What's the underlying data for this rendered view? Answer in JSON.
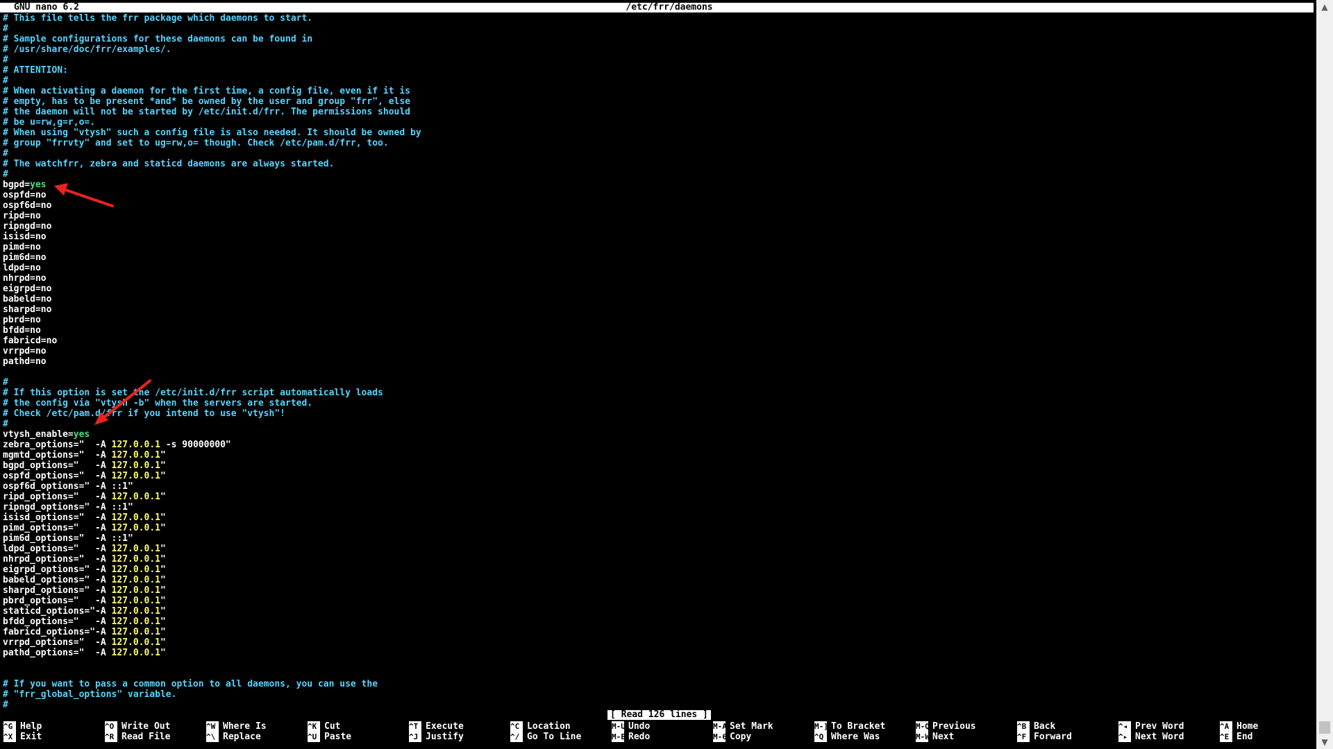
{
  "window": {
    "app_version": "GNU nano 6.2",
    "file_path": "/etc/frr/daemons"
  },
  "editor": {
    "lines": [
      [
        {
          "t": "# This file tells the frr package which daemons to start.",
          "c": "comment"
        }
      ],
      [
        {
          "t": "#",
          "c": "comment"
        }
      ],
      [
        {
          "t": "# Sample configurations for these daemons can be found in",
          "c": "comment"
        }
      ],
      [
        {
          "t": "# /usr/share/doc/frr/examples/.",
          "c": "comment"
        }
      ],
      [
        {
          "t": "#",
          "c": "comment"
        }
      ],
      [
        {
          "t": "# ATTENTION:",
          "c": "comment"
        }
      ],
      [
        {
          "t": "#",
          "c": "comment"
        }
      ],
      [
        {
          "t": "# When activating a daemon for the first time, a config file, even if it is",
          "c": "comment"
        }
      ],
      [
        {
          "t": "# empty, has to be present *and* be owned by the user and group \"frr\", else",
          "c": "comment"
        }
      ],
      [
        {
          "t": "# the daemon will not be started by /etc/init.d/frr. The permissions should",
          "c": "comment"
        }
      ],
      [
        {
          "t": "# be u=rw,g=r,o=.",
          "c": "comment"
        }
      ],
      [
        {
          "t": "# When using \"vtysh\" such a config file is also needed. It should be owned by",
          "c": "comment"
        }
      ],
      [
        {
          "t": "# group \"frrvty\" and set to ug=rw,o= though. Check /etc/pam.d/frr, too.",
          "c": "comment"
        }
      ],
      [
        {
          "t": "#",
          "c": "comment"
        }
      ],
      [
        {
          "t": "# The watchfrr, zebra and staticd daemons are always started.",
          "c": "comment"
        }
      ],
      [
        {
          "t": "#",
          "c": "comment"
        }
      ],
      [
        {
          "t": "bgpd=",
          "c": "default"
        },
        {
          "t": "yes",
          "c": "green"
        }
      ],
      [
        {
          "t": "ospfd=no",
          "c": "default"
        }
      ],
      [
        {
          "t": "ospf6d=no",
          "c": "default"
        }
      ],
      [
        {
          "t": "ripd=no",
          "c": "default"
        }
      ],
      [
        {
          "t": "ripngd=no",
          "c": "default"
        }
      ],
      [
        {
          "t": "isisd=no",
          "c": "default"
        }
      ],
      [
        {
          "t": "pimd=no",
          "c": "default"
        }
      ],
      [
        {
          "t": "pim6d=no",
          "c": "default"
        }
      ],
      [
        {
          "t": "ldpd=no",
          "c": "default"
        }
      ],
      [
        {
          "t": "nhrpd=no",
          "c": "default"
        }
      ],
      [
        {
          "t": "eigrpd=no",
          "c": "default"
        }
      ],
      [
        {
          "t": "babeld=no",
          "c": "default"
        }
      ],
      [
        {
          "t": "sharpd=no",
          "c": "default"
        }
      ],
      [
        {
          "t": "pbrd=no",
          "c": "default"
        }
      ],
      [
        {
          "t": "bfdd=no",
          "c": "default"
        }
      ],
      [
        {
          "t": "fabricd=no",
          "c": "default"
        }
      ],
      [
        {
          "t": "vrrpd=no",
          "c": "default"
        }
      ],
      [
        {
          "t": "pathd=no",
          "c": "default"
        }
      ],
      [],
      [
        {
          "t": "#",
          "c": "comment"
        }
      ],
      [
        {
          "t": "# If this option is set the /etc/init.d/frr script automatically loads",
          "c": "comment"
        }
      ],
      [
        {
          "t": "# the config via \"vtysh -b\" when the servers are started.",
          "c": "comment"
        }
      ],
      [
        {
          "t": "# Check /etc/pam.d/frr if you intend to use \"vtysh\"!",
          "c": "comment"
        }
      ],
      [
        {
          "t": "#",
          "c": "comment"
        }
      ],
      [
        {
          "t": "vtysh_enable=",
          "c": "default"
        },
        {
          "t": "yes",
          "c": "green"
        }
      ],
      [
        {
          "t": "zebra_options=\"  -A ",
          "c": "default"
        },
        {
          "t": "127.0.0.1",
          "c": "yellow"
        },
        {
          "t": " -s 90000000\"",
          "c": "default"
        }
      ],
      [
        {
          "t": "mgmtd_options=\"  -A ",
          "c": "default"
        },
        {
          "t": "127.0.0.1",
          "c": "yellow"
        },
        {
          "t": "\"",
          "c": "default"
        }
      ],
      [
        {
          "t": "bgpd_options=\"   -A ",
          "c": "default"
        },
        {
          "t": "127.0.0.1",
          "c": "yellow"
        },
        {
          "t": "\"",
          "c": "default"
        }
      ],
      [
        {
          "t": "ospfd_options=\"  -A ",
          "c": "default"
        },
        {
          "t": "127.0.0.1",
          "c": "yellow"
        },
        {
          "t": "\"",
          "c": "default"
        }
      ],
      [
        {
          "t": "ospf6d_options=\" -A ::1\"",
          "c": "default"
        }
      ],
      [
        {
          "t": "ripd_options=\"   -A ",
          "c": "default"
        },
        {
          "t": "127.0.0.1",
          "c": "yellow"
        },
        {
          "t": "\"",
          "c": "default"
        }
      ],
      [
        {
          "t": "ripngd_options=\" -A ::1\"",
          "c": "default"
        }
      ],
      [
        {
          "t": "isisd_options=\"  -A ",
          "c": "default"
        },
        {
          "t": "127.0.0.1",
          "c": "yellow"
        },
        {
          "t": "\"",
          "c": "default"
        }
      ],
      [
        {
          "t": "pimd_options=\"   -A ",
          "c": "default"
        },
        {
          "t": "127.0.0.1",
          "c": "yellow"
        },
        {
          "t": "\"",
          "c": "default"
        }
      ],
      [
        {
          "t": "pim6d_options=\"  -A ::1\"",
          "c": "default"
        }
      ],
      [
        {
          "t": "ldpd_options=\"   -A ",
          "c": "default"
        },
        {
          "t": "127.0.0.1",
          "c": "yellow"
        },
        {
          "t": "\"",
          "c": "default"
        }
      ],
      [
        {
          "t": "nhrpd_options=\"  -A ",
          "c": "default"
        },
        {
          "t": "127.0.0.1",
          "c": "yellow"
        },
        {
          "t": "\"",
          "c": "default"
        }
      ],
      [
        {
          "t": "eigrpd_options=\" -A ",
          "c": "default"
        },
        {
          "t": "127.0.0.1",
          "c": "yellow"
        },
        {
          "t": "\"",
          "c": "default"
        }
      ],
      [
        {
          "t": "babeld_options=\" -A ",
          "c": "default"
        },
        {
          "t": "127.0.0.1",
          "c": "yellow"
        },
        {
          "t": "\"",
          "c": "default"
        }
      ],
      [
        {
          "t": "sharpd_options=\" -A ",
          "c": "default"
        },
        {
          "t": "127.0.0.1",
          "c": "yellow"
        },
        {
          "t": "\"",
          "c": "default"
        }
      ],
      [
        {
          "t": "pbrd_options=\"   -A ",
          "c": "default"
        },
        {
          "t": "127.0.0.1",
          "c": "yellow"
        },
        {
          "t": "\"",
          "c": "default"
        }
      ],
      [
        {
          "t": "staticd_options=\"-A ",
          "c": "default"
        },
        {
          "t": "127.0.0.1",
          "c": "yellow"
        },
        {
          "t": "\"",
          "c": "default"
        }
      ],
      [
        {
          "t": "bfdd_options=\"   -A ",
          "c": "default"
        },
        {
          "t": "127.0.0.1",
          "c": "yellow"
        },
        {
          "t": "\"",
          "c": "default"
        }
      ],
      [
        {
          "t": "fabricd_options=\"-A ",
          "c": "default"
        },
        {
          "t": "127.0.0.1",
          "c": "yellow"
        },
        {
          "t": "\"",
          "c": "default"
        }
      ],
      [
        {
          "t": "vrrpd_options=\"  -A ",
          "c": "default"
        },
        {
          "t": "127.0.0.1",
          "c": "yellow"
        },
        {
          "t": "\"",
          "c": "default"
        }
      ],
      [
        {
          "t": "pathd_options=\"  -A ",
          "c": "default"
        },
        {
          "t": "127.0.0.1",
          "c": "yellow"
        },
        {
          "t": "\"",
          "c": "default"
        }
      ],
      [],
      [],
      [
        {
          "t": "# If you want to pass a common option to all daemons, you can use the",
          "c": "comment"
        }
      ],
      [
        {
          "t": "# \"frr_global_options\" variable.",
          "c": "comment"
        }
      ],
      [
        {
          "t": "#",
          "c": "comment"
        }
      ]
    ]
  },
  "status_message": "[ Read 126 lines ]",
  "shortcuts": [
    {
      "key": "^G",
      "label": "Help",
      "name": "help"
    },
    {
      "key": "^X",
      "label": "Exit",
      "name": "exit"
    },
    {
      "key": "^O",
      "label": "Write Out",
      "name": "write-out"
    },
    {
      "key": "^R",
      "label": "Read File",
      "name": "read-file"
    },
    {
      "key": "^W",
      "label": "Where Is",
      "name": "where-is"
    },
    {
      "key": "^\\",
      "label": "Replace",
      "name": "replace"
    },
    {
      "key": "^K",
      "label": "Cut",
      "name": "cut"
    },
    {
      "key": "^U",
      "label": "Paste",
      "name": "paste"
    },
    {
      "key": "^T",
      "label": "Execute",
      "name": "execute"
    },
    {
      "key": "^J",
      "label": "Justify",
      "name": "justify"
    },
    {
      "key": "^C",
      "label": "Location",
      "name": "location"
    },
    {
      "key": "^/",
      "label": "Go To Line",
      "name": "go-to-line"
    },
    {
      "key": "M-U",
      "label": "Undo",
      "name": "undo"
    },
    {
      "key": "M-E",
      "label": "Redo",
      "name": "redo"
    },
    {
      "key": "M-A",
      "label": "Set Mark",
      "name": "set-mark"
    },
    {
      "key": "M-6",
      "label": "Copy",
      "name": "copy"
    },
    {
      "key": "M-]",
      "label": "To Bracket",
      "name": "to-bracket"
    },
    {
      "key": "^Q",
      "label": "Where Was",
      "name": "where-was"
    },
    {
      "key": "M-Q",
      "label": "Previous",
      "name": "previous"
    },
    {
      "key": "M-W",
      "label": "Next",
      "name": "next"
    },
    {
      "key": "^B",
      "label": "Back",
      "name": "back"
    },
    {
      "key": "^F",
      "label": "Forward",
      "name": "forward"
    },
    {
      "key": "^◂",
      "label": "Prev Word",
      "name": "prev-word"
    },
    {
      "key": "^▸",
      "label": "Next Word",
      "name": "next-word"
    },
    {
      "key": "^A",
      "label": "Home",
      "name": "home"
    },
    {
      "key": "^E",
      "label": "End",
      "name": "end"
    }
  ],
  "scrollbar": {
    "up_icon": "▲",
    "down_icon": "▼"
  },
  "colors": {
    "comment": "#55d5ff",
    "default": "#ffffff",
    "green": "#4ce07f",
    "yellow": "#ffff66",
    "annotation_arrow": "#e8231f"
  }
}
